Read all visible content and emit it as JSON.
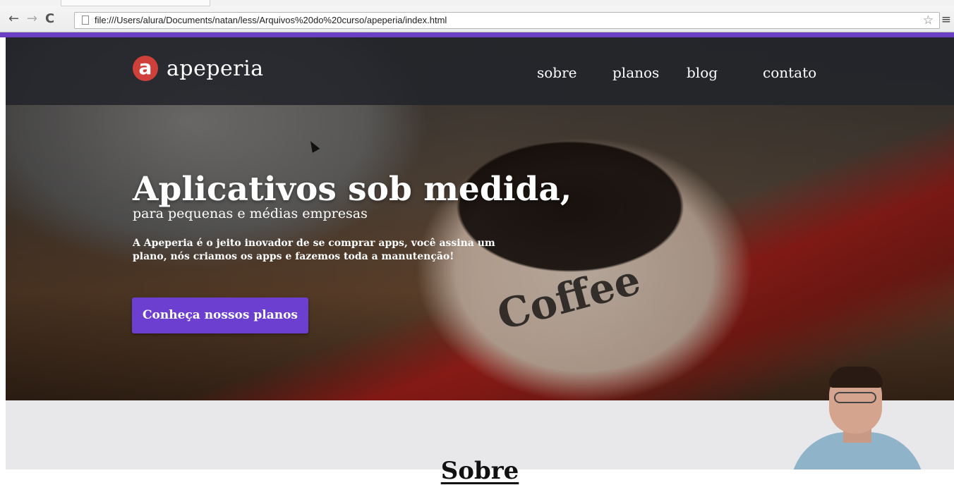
{
  "browser": {
    "url": "file:///Users/alura/Documents/natan/less/Arquivos%20do%20curso/apeperia/index.html",
    "back_icon": "←",
    "forward_icon": "→",
    "reload_icon": "C",
    "star_icon": "☆",
    "menu_icon": "≡"
  },
  "site": {
    "logo_letter": "a",
    "logo_text": "apeperia",
    "nav": [
      "sobre",
      "planos",
      "blog",
      "contato"
    ],
    "accent_color": "#6d3fd0",
    "logo_color": "#d0403b"
  },
  "hero": {
    "headline": "Aplicativos sob medida,",
    "subhead": "para pequenas e médias empresas",
    "intro": "A Apeperia é o jeito inovador de se comprar apps, você assina um plano, nós criamos os apps e fazemos toda a manutenção!",
    "cta_label": "Conheça nossos planos",
    "mug_text": "Coffee"
  },
  "about": {
    "title": "Sobre"
  }
}
